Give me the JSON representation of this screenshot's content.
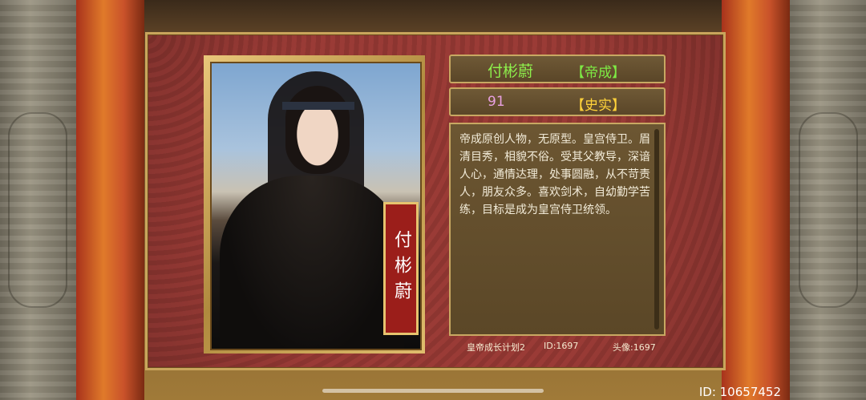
{
  "character": {
    "name": "付彬蔚",
    "origin_tag": "【帝成】",
    "number": "91",
    "history_tag": "【史实】",
    "plaque_name": "付彬蔚",
    "bio": "帝成原创人物，无原型。皇宫侍卫。眉清目秀，相貌不俗。受其父教导，深谙人心，通情达理，处事圆融，从不苛责人，朋友众多。喜欢剑术，自幼勤学苦练，目标是成为皇宫侍卫统领。"
  },
  "footer": {
    "plan": "皇帝成长计划2",
    "id": "ID:1697",
    "avatar": "头像:1697"
  },
  "screen": {
    "user_id": "ID: 10657452"
  },
  "colors": {
    "card_bg": "#8e3631",
    "gold_border": "#c9a55c",
    "name_green": "#8ef04c",
    "history_yellow": "#ffd23a",
    "number_pink": "#e8a0e0"
  }
}
